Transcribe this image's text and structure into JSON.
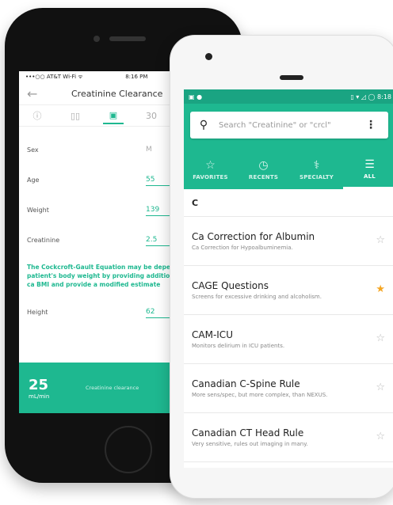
{
  "iphone": {
    "status": {
      "carrier": "•••○○ AT&T Wi-Fi ᯤ",
      "time": "8:16 PM"
    },
    "title": "Creatinine Clearance",
    "fields": [
      {
        "label": "Sex",
        "value": "M"
      },
      {
        "label": "Age",
        "value": "55"
      },
      {
        "label": "Weight",
        "value": "139"
      },
      {
        "label": "Creatinine",
        "value": "2.5"
      }
    ],
    "note": "The Cockcroft-Gault Equation may be depending on a patient's body weight by providing additional height, we ca BMI and provide a modified estimate",
    "height_field": {
      "label": "Height",
      "value": "62"
    },
    "result": {
      "value": "25",
      "unit": "mL/min",
      "label": "Creatinine clearance"
    }
  },
  "android": {
    "status": {
      "time": "8:18"
    },
    "search": {
      "placeholder": "Search \"Creatinine\" or \"crcl\""
    },
    "tabs": [
      {
        "label": "FAVORITES",
        "icon": "star-icon"
      },
      {
        "label": "RECENTS",
        "icon": "clock-icon"
      },
      {
        "label": "SPECIALTY",
        "icon": "stethoscope-icon"
      },
      {
        "label": "ALL",
        "icon": "list-icon",
        "active": true
      }
    ],
    "section": "C",
    "items": [
      {
        "title": "Ca Correction for Albumin",
        "subtitle": "Ca Correction for Hypoalbuminemia.",
        "favorite": false
      },
      {
        "title": "CAGE Questions",
        "subtitle": "Screens for excessive drinking and alcoholism.",
        "favorite": true
      },
      {
        "title": "CAM-ICU",
        "subtitle": "Monitors delirium in ICU patients.",
        "favorite": false
      },
      {
        "title": "Canadian C-Spine Rule",
        "subtitle": "More sens/spec, but more complex, than NEXUS.",
        "favorite": false
      },
      {
        "title": "Canadian CT Head Rule",
        "subtitle": "Very sensitive, rules out imaging in many.",
        "favorite": false
      }
    ],
    "colors": {
      "accent": "#1eb890",
      "star_active": "#f5a623"
    }
  }
}
